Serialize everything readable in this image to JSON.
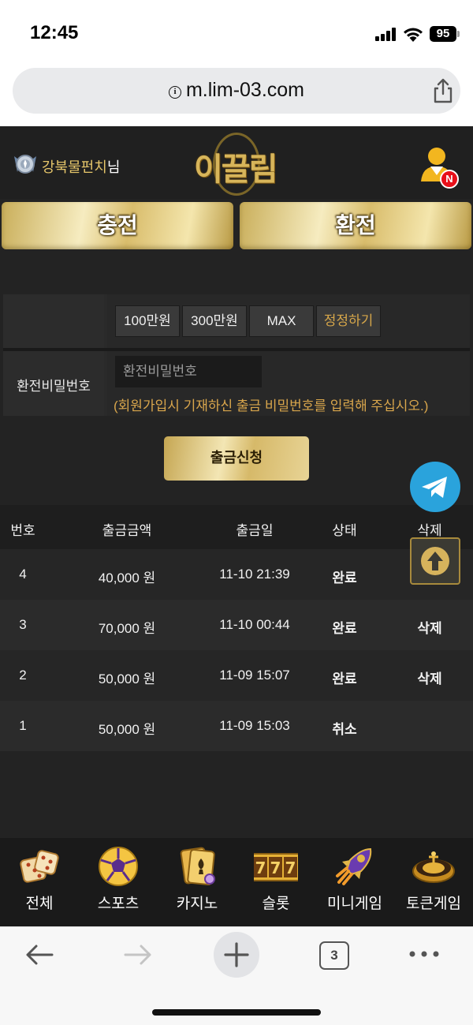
{
  "status_bar": {
    "time": "12:45",
    "battery": "95"
  },
  "browser": {
    "url": "m.lim-03.com",
    "tab_count": "3"
  },
  "header": {
    "nickname": "강북물펀치",
    "suffix": "님",
    "logo_text": "이끌림",
    "notification_badge": "N"
  },
  "main_buttons": {
    "charge": "충전",
    "exchange": "환전"
  },
  "form": {
    "amount_buttons": [
      "100만원",
      "300만원",
      "MAX",
      "정정하기"
    ],
    "password_label": "환전비밀번호",
    "password_placeholder": "환전비밀번호",
    "password_hint": "(회원가입시 기재하신 출금 비밀번호를 입력해 주십시오.)",
    "submit": "출금신청"
  },
  "table": {
    "headers": [
      "번호",
      "출금금액",
      "출금일",
      "상태",
      "삭제"
    ],
    "rows": [
      {
        "no": "4",
        "amount": "40,000 원",
        "date": "11-10 21:39",
        "status": "완료",
        "delete": ""
      },
      {
        "no": "3",
        "amount": "70,000 원",
        "date": "11-10 00:44",
        "status": "완료",
        "delete": "삭제"
      },
      {
        "no": "2",
        "amount": "50,000 원",
        "date": "11-09 15:07",
        "status": "완료",
        "delete": "삭제"
      },
      {
        "no": "1",
        "amount": "50,000 원",
        "date": "11-09 15:03",
        "status": "취소",
        "delete": ""
      }
    ]
  },
  "bottom_nav": [
    {
      "label": "전체",
      "icon": "dice-icon"
    },
    {
      "label": "스포츠",
      "icon": "soccer-ball-icon"
    },
    {
      "label": "카지노",
      "icon": "playing-cards-icon"
    },
    {
      "label": "슬롯",
      "icon": "slot-777-icon"
    },
    {
      "label": "미니게임",
      "icon": "rocket-icon"
    },
    {
      "label": "토큰게임",
      "icon": "roulette-icon"
    }
  ],
  "colors": {
    "gold": "#d7b55a",
    "hint": "#d9a64c",
    "telegram": "#2aa3dc",
    "notification": "#e8101a"
  }
}
